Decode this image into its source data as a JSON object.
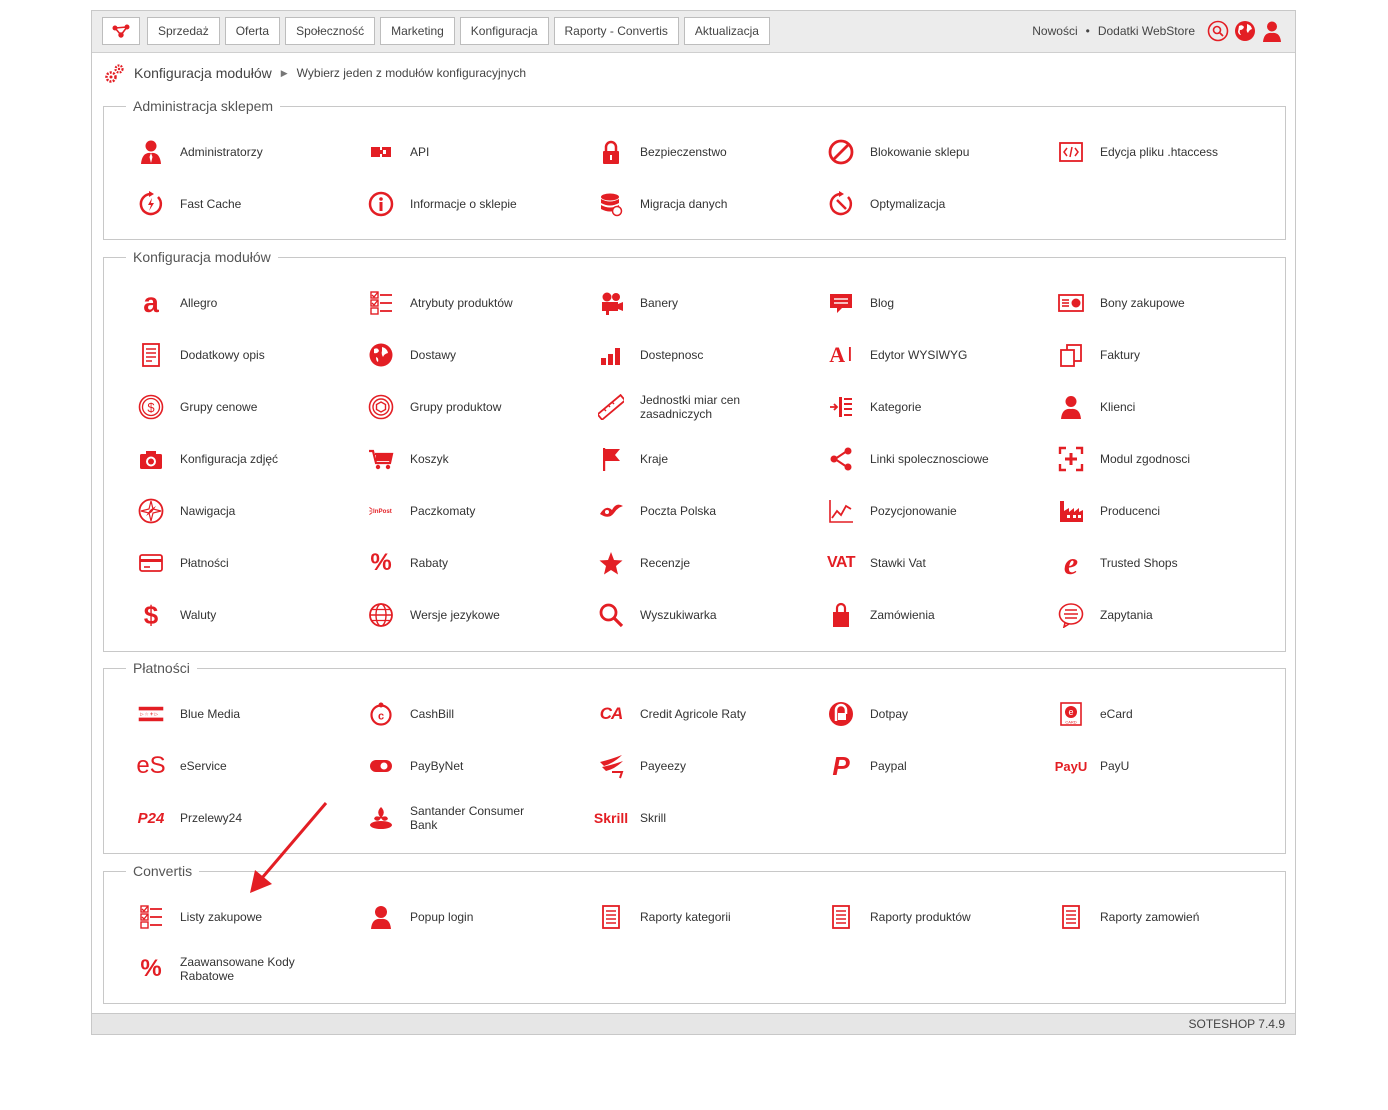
{
  "colors": {
    "accent": "#e31e24",
    "topbar_bg": "#ececec"
  },
  "nav": {
    "logo_icon": "soteshop-logo-icon",
    "tabs": [
      "Sprzedaż",
      "Oferta",
      "Społeczność",
      "Marketing",
      "Konfiguracja",
      "Raporty - Convertis",
      "Aktualizacja"
    ],
    "links": [
      "Nowości",
      "Dodatki WebStore"
    ],
    "link_separator": "•",
    "icons": [
      "search-icon",
      "globe-icon",
      "user-icon"
    ]
  },
  "breadcrumb": {
    "icon": "gears-icon",
    "title": "Konfiguracja modułów",
    "arrow": "▶",
    "subtitle": "Wybierz jeden z modułów konfiguracyjnych"
  },
  "sections": [
    {
      "title": "Administracja sklepem",
      "items": [
        {
          "label": "Administratorzy",
          "icon": "admin-user-icon"
        },
        {
          "label": "API",
          "icon": "api-plug-icon"
        },
        {
          "label": "Bezpieczenstwo",
          "icon": "padlock-icon"
        },
        {
          "label": "Blokowanie sklepu",
          "icon": "blocked-icon"
        },
        {
          "label": "Edycja pliku .htaccess",
          "icon": "code-file-icon"
        },
        {
          "label": "Fast Cache",
          "icon": "fast-cache-icon"
        },
        {
          "label": "Informacje o sklepie",
          "icon": "info-icon"
        },
        {
          "label": "Migracja danych",
          "icon": "database-icon"
        },
        {
          "label": "Optymalizacja",
          "icon": "optimize-icon"
        }
      ]
    },
    {
      "title": "Konfiguracja modułów",
      "items": [
        {
          "label": "Allegro",
          "icon": "allegro-icon"
        },
        {
          "label": "Atrybuty produktów",
          "icon": "checklist-icon"
        },
        {
          "label": "Banery",
          "icon": "projector-icon"
        },
        {
          "label": "Blog",
          "icon": "comment-icon"
        },
        {
          "label": "Bony zakupowe",
          "icon": "voucher-icon"
        },
        {
          "label": "Dodatkowy opis",
          "icon": "document-icon"
        },
        {
          "label": "Dostawy",
          "icon": "globe-delivery-icon"
        },
        {
          "label": "Dostepnosc",
          "icon": "availability-bars-icon"
        },
        {
          "label": "Edytor WYSIWYG",
          "icon": "text-editor-icon"
        },
        {
          "label": "Faktury",
          "icon": "copy-icon"
        },
        {
          "label": "Grupy cenowe",
          "icon": "dollar-coin-icon"
        },
        {
          "label": "Grupy produktow",
          "icon": "product-group-icon"
        },
        {
          "label": "Jednostki miar cen zasadniczych",
          "icon": "ruler-icon"
        },
        {
          "label": "Kategorie",
          "icon": "category-list-icon"
        },
        {
          "label": "Klienci",
          "icon": "client-icon"
        },
        {
          "label": "Konfiguracja zdjęć",
          "icon": "camera-icon"
        },
        {
          "label": "Koszyk",
          "icon": "cart-icon"
        },
        {
          "label": "Kraje",
          "icon": "flag-icon"
        },
        {
          "label": "Linki spolecznosciowe",
          "icon": "share-icon"
        },
        {
          "label": "Modul zgodnosci",
          "icon": "compliance-icon"
        },
        {
          "label": "Nawigacja",
          "icon": "compass-icon"
        },
        {
          "label": "Paczkomaty",
          "icon": "inpost-icon"
        },
        {
          "label": "Poczta Polska",
          "icon": "poczta-polska-icon"
        },
        {
          "label": "Pozycjonowanie",
          "icon": "chart-line-icon"
        },
        {
          "label": "Producenci",
          "icon": "factory-icon"
        },
        {
          "label": "Płatności",
          "icon": "credit-card-icon"
        },
        {
          "label": "Rabaty",
          "icon": "percent-icon"
        },
        {
          "label": "Recenzje",
          "icon": "star-icon"
        },
        {
          "label": "Stawki Vat",
          "icon": "vat-icon"
        },
        {
          "label": "Trusted Shops",
          "icon": "trusted-shops-icon"
        },
        {
          "label": "Waluty",
          "icon": "dollar-icon"
        },
        {
          "label": "Wersje jezykowe",
          "icon": "language-globe-icon"
        },
        {
          "label": "Wyszukiwarka",
          "icon": "search-icon"
        },
        {
          "label": "Zamówienia",
          "icon": "shopping-bag-icon"
        },
        {
          "label": "Zapytania",
          "icon": "inquiry-icon"
        }
      ]
    },
    {
      "title": "Płatności",
      "items": [
        {
          "label": "Blue Media",
          "icon": "blue-media-icon"
        },
        {
          "label": "CashBill",
          "icon": "cashbill-icon"
        },
        {
          "label": "Credit Agricole Raty",
          "icon": "credit-agricole-icon"
        },
        {
          "label": "Dotpay",
          "icon": "dotpay-icon"
        },
        {
          "label": "eCard",
          "icon": "ecard-icon"
        },
        {
          "label": "eService",
          "icon": "eservice-icon",
          "logo_text": "eS"
        },
        {
          "label": "PayByNet",
          "icon": "paybynet-icon"
        },
        {
          "label": "Payeezy",
          "icon": "payeezy-icon"
        },
        {
          "label": "Paypal",
          "icon": "paypal-icon"
        },
        {
          "label": "PayU",
          "icon": "payu-icon",
          "logo_text": "PayU"
        },
        {
          "label": "Przelewy24",
          "icon": "przelewy24-icon",
          "logo_text": "P24"
        },
        {
          "label": "Santander Consumer Bank",
          "icon": "santander-icon"
        },
        {
          "label": "Skrill",
          "icon": "skrill-icon",
          "logo_text": "Skrill"
        }
      ]
    },
    {
      "title": "Convertis",
      "items": [
        {
          "label": "Listy zakupowe",
          "icon": "checklist-icon"
        },
        {
          "label": "Popup login",
          "icon": "user-icon"
        },
        {
          "label": "Raporty kategorii",
          "icon": "report-icon"
        },
        {
          "label": "Raporty produktów",
          "icon": "report-icon"
        },
        {
          "label": "Raporty zamowień",
          "icon": "report-icon"
        },
        {
          "label": "Zaawansowane Kody Rabatowe",
          "icon": "percent-icon"
        }
      ]
    }
  ],
  "footer": {
    "version": "SOTESHOP 7.4.9"
  }
}
